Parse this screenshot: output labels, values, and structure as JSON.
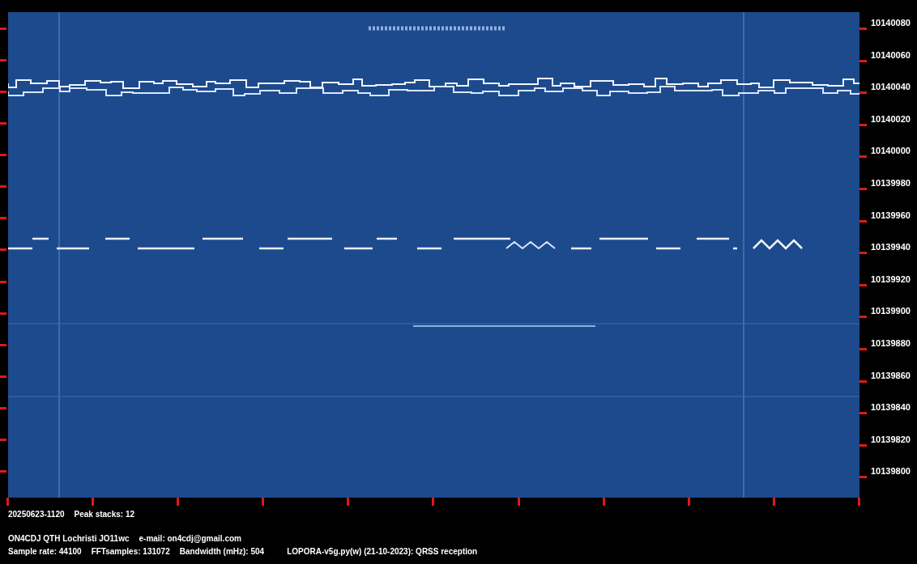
{
  "frequency_axis": {
    "labels": [
      "10140080",
      "10140060",
      "10140040",
      "10140020",
      "10140000",
      "10139980",
      "10139960",
      "10139940",
      "10139920",
      "10139900",
      "10139880",
      "10139860",
      "10139840",
      "10139820",
      "10139800"
    ]
  },
  "footer": {
    "status": [
      "20250623-1120",
      "Peak stacks: 12"
    ],
    "lines": [
      [
        "ON4CDJ QTH Lochristi JO11wc",
        "e-mail: on4cdj@gmail.com"
      ],
      [
        "Sample rate: 44100",
        "FFTsamples: 131072",
        "Bandwidth (mHz): 504",
        "LOPORA-v5g.py(w) (21-10-2023): QRSS reception"
      ]
    ]
  }
}
